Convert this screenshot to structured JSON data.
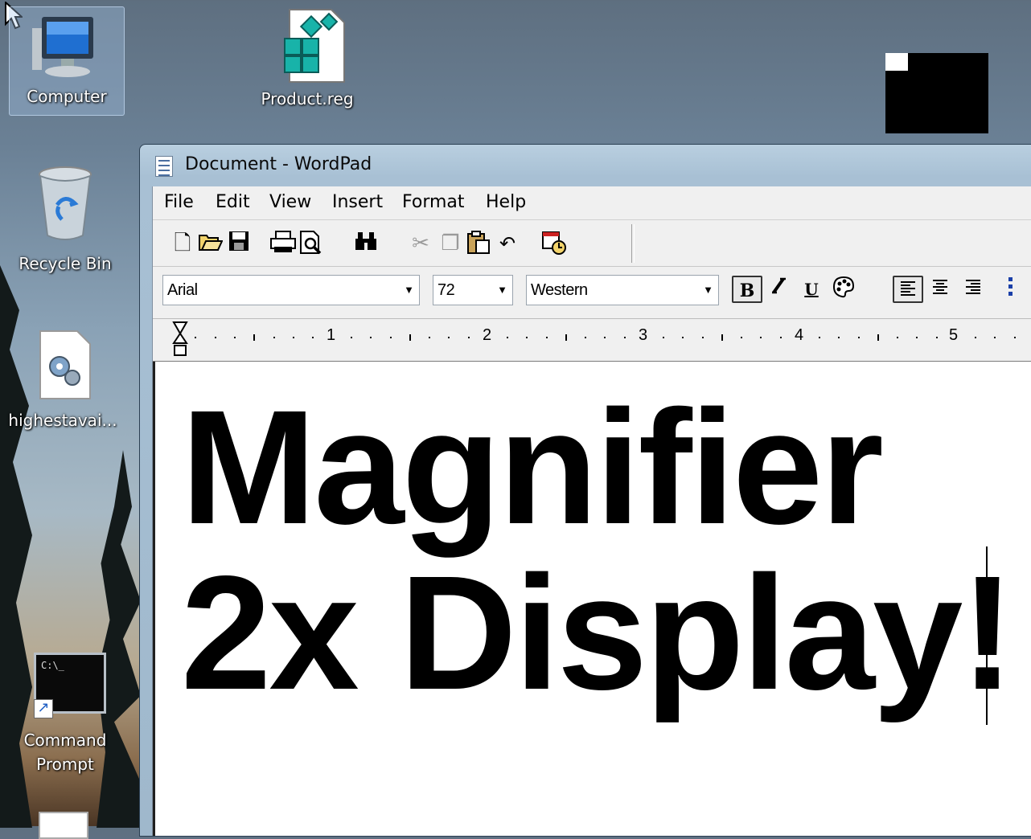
{
  "desktop": {
    "icons": [
      {
        "label": "Computer",
        "icon": "computer-icon"
      },
      {
        "label": "Product.reg",
        "icon": "registry-file-icon"
      },
      {
        "label": "Recycle Bin",
        "icon": "recycle-bin-icon"
      },
      {
        "label": "highestavai...",
        "icon": "settings-file-icon"
      },
      {
        "label_line1": "Command",
        "label_line2": "Prompt",
        "icon": "command-prompt-icon",
        "console_text": "C:\\_"
      }
    ]
  },
  "window": {
    "title": "Document - WordPad",
    "menu": [
      "File",
      "Edit",
      "View",
      "Insert",
      "Format",
      "Help"
    ],
    "toolbar": [
      "new-icon",
      "open-icon",
      "save-icon",
      "print-icon",
      "print-preview-icon",
      "find-icon",
      "cut-icon",
      "copy-icon",
      "paste-icon",
      "undo-icon",
      "date-time-icon"
    ],
    "format": {
      "font": "Arial",
      "size": "72",
      "script": "Western",
      "bold_label": "B",
      "underline_label": "U",
      "bold_active": true,
      "align_left_active": true
    },
    "ruler": {
      "numbers": [
        "1",
        "2",
        "3",
        "4",
        "5"
      ]
    },
    "document": {
      "line1": "Magnifier",
      "line2": "2x Display!"
    }
  },
  "colors": {
    "window_frame": "#a8c0d4",
    "client_bg": "#f0f0f0",
    "document_bg": "#ffffff",
    "text": "#000000"
  }
}
